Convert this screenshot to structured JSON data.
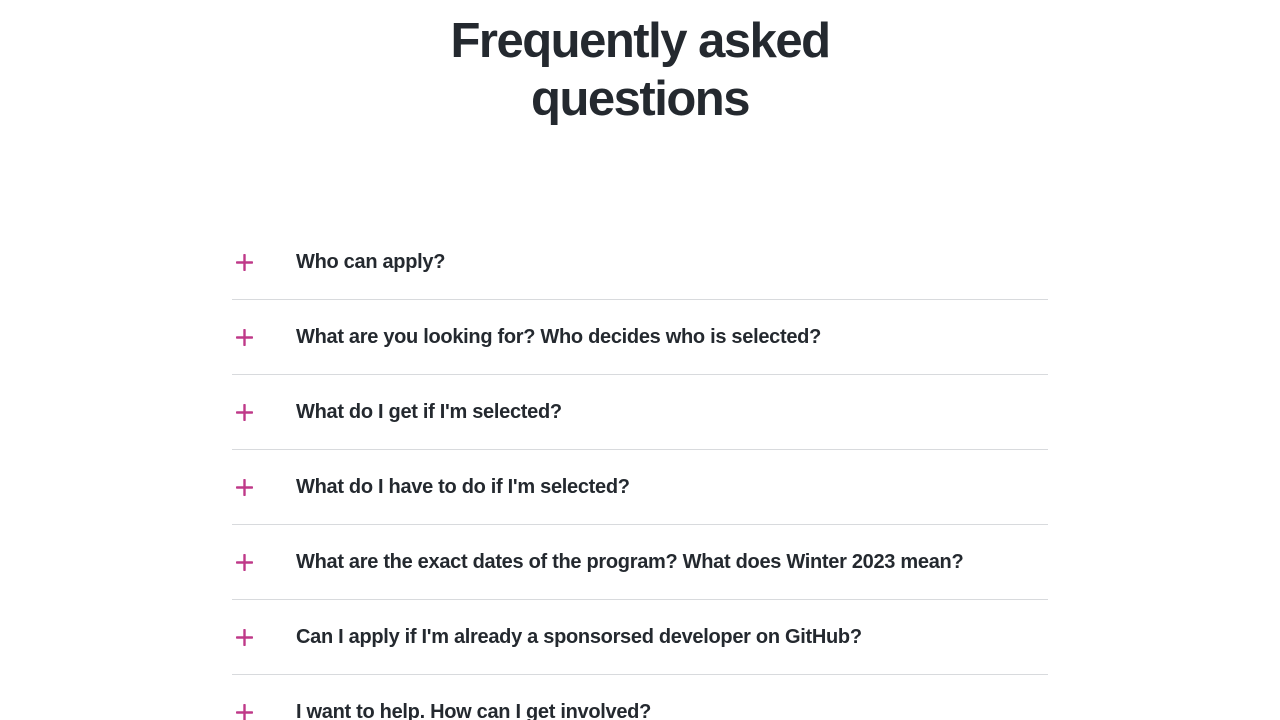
{
  "heading": {
    "line1": "Frequently asked",
    "line2": "questions"
  },
  "accent_color": "#bf3989",
  "faq": {
    "toggle_icon": "plus-icon",
    "items": [
      {
        "question": "Who can apply?"
      },
      {
        "question": "What are you looking for? Who decides who is selected?"
      },
      {
        "question": "What do I get if I'm selected?"
      },
      {
        "question": "What do I have to do if I'm selected?"
      },
      {
        "question": "What are the exact dates of the program? What does Winter 2023 mean?"
      },
      {
        "question": "Can I apply if I'm already a sponsorsed developer on GitHub?"
      },
      {
        "question": "I want to help. How can I get involved?"
      }
    ]
  }
}
